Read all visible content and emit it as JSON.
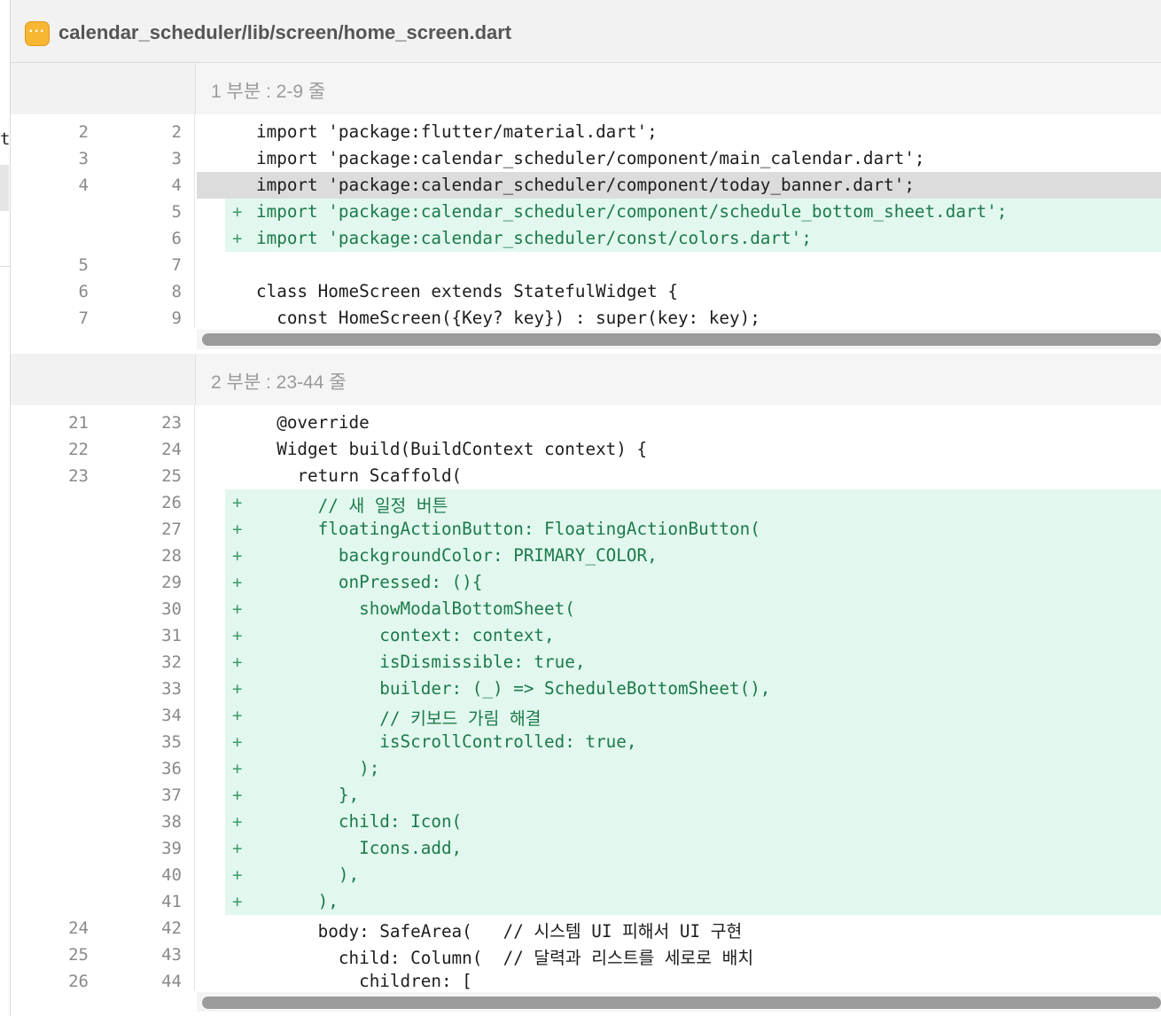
{
  "window": {
    "file_path": "calendar_scheduler/lib/screen/home_screen.dart",
    "file_icon": "ellipsis-icon"
  },
  "left_fragment": "t",
  "sections": [
    {
      "title": "1 부분 : 2-9 줄",
      "lines": [
        {
          "old": "2",
          "new": "2",
          "type": "context",
          "code": "import 'package:flutter/material.dart';"
        },
        {
          "old": "3",
          "new": "3",
          "type": "context",
          "code": "import 'package:calendar_scheduler/component/main_calendar.dart';"
        },
        {
          "old": "4",
          "new": "4",
          "type": "highlight",
          "code": "import 'package:calendar_scheduler/component/today_banner.dart';"
        },
        {
          "old": "",
          "new": "5",
          "type": "added",
          "code": "import 'package:calendar_scheduler/component/schedule_bottom_sheet.dart';"
        },
        {
          "old": "",
          "new": "6",
          "type": "added",
          "code": "import 'package:calendar_scheduler/const/colors.dart';"
        },
        {
          "old": "5",
          "new": "7",
          "type": "context",
          "code": ""
        },
        {
          "old": "6",
          "new": "8",
          "type": "context",
          "code": "class HomeScreen extends StatefulWidget {"
        },
        {
          "old": "7",
          "new": "9",
          "type": "context",
          "code": "  const HomeScreen({Key? key}) : super(key: key);"
        }
      ]
    },
    {
      "title": "2 부분 : 23-44 줄",
      "lines": [
        {
          "old": "21",
          "new": "23",
          "type": "context",
          "code": "  @override"
        },
        {
          "old": "22",
          "new": "24",
          "type": "context",
          "code": "  Widget build(BuildContext context) {"
        },
        {
          "old": "23",
          "new": "25",
          "type": "context",
          "code": "    return Scaffold("
        },
        {
          "old": "",
          "new": "26",
          "type": "added",
          "code": "      // 새 일정 버튼"
        },
        {
          "old": "",
          "new": "27",
          "type": "added",
          "code": "      floatingActionButton: FloatingActionButton("
        },
        {
          "old": "",
          "new": "28",
          "type": "added",
          "code": "        backgroundColor: PRIMARY_COLOR,"
        },
        {
          "old": "",
          "new": "29",
          "type": "added",
          "code": "        onPressed: (){"
        },
        {
          "old": "",
          "new": "30",
          "type": "added",
          "code": "          showModalBottomSheet("
        },
        {
          "old": "",
          "new": "31",
          "type": "added",
          "code": "            context: context,"
        },
        {
          "old": "",
          "new": "32",
          "type": "added",
          "code": "            isDismissible: true,"
        },
        {
          "old": "",
          "new": "33",
          "type": "added",
          "code": "            builder: (_) => ScheduleBottomSheet(),"
        },
        {
          "old": "",
          "new": "34",
          "type": "added",
          "code": "            // 키보드 가림 해결"
        },
        {
          "old": "",
          "new": "35",
          "type": "added",
          "code": "            isScrollControlled: true,"
        },
        {
          "old": "",
          "new": "36",
          "type": "added",
          "code": "          );"
        },
        {
          "old": "",
          "new": "37",
          "type": "added",
          "code": "        },"
        },
        {
          "old": "",
          "new": "38",
          "type": "added",
          "code": "        child: Icon("
        },
        {
          "old": "",
          "new": "39",
          "type": "added",
          "code": "          Icons.add,"
        },
        {
          "old": "",
          "new": "40",
          "type": "added",
          "code": "        ),"
        },
        {
          "old": "",
          "new": "41",
          "type": "added",
          "code": "      ),"
        },
        {
          "old": "24",
          "new": "42",
          "type": "context",
          "code": "      body: SafeArea(   // 시스템 UI 피해서 UI 구현"
        },
        {
          "old": "25",
          "new": "43",
          "type": "context",
          "code": "        child: Column(  // 달력과 리스트를 세로로 배치"
        },
        {
          "old": "26",
          "new": "44",
          "type": "context",
          "code": "          children: ["
        }
      ]
    }
  ],
  "added_sign": "+",
  "colors": {
    "added_bg": "#e2f8ee",
    "added_text": "#1c7a4c",
    "highlight_bg": "#dcdcdc",
    "header_bg": "#f2f2f2",
    "icon_bg": "#f7b733"
  }
}
